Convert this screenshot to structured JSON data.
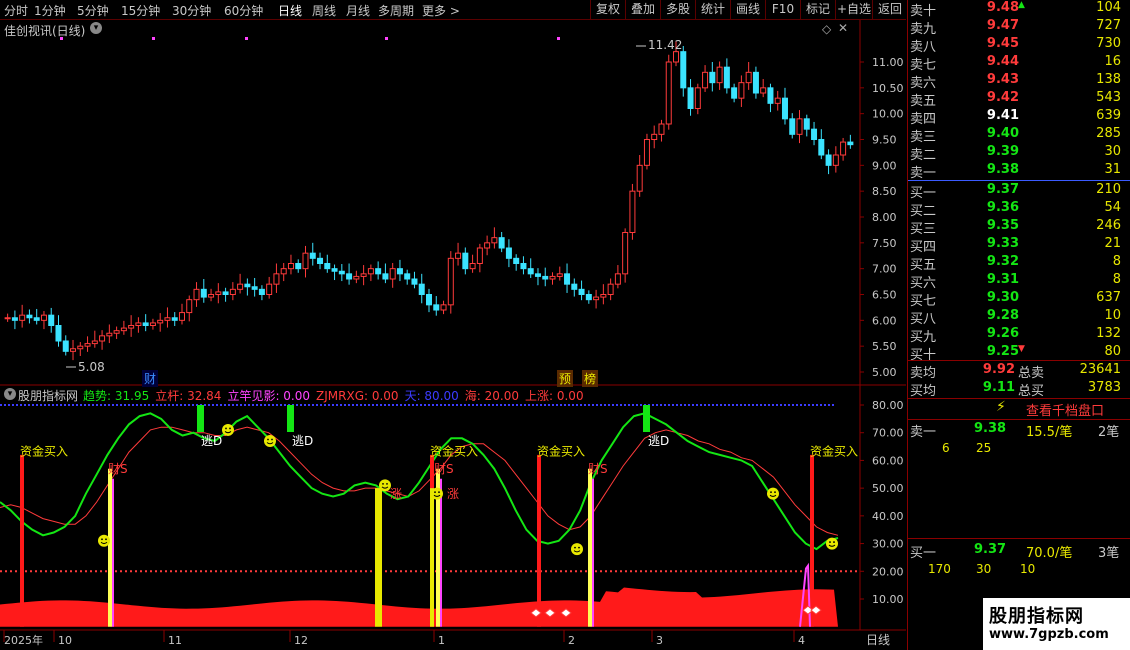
{
  "toolbar": {
    "periods": [
      "分时",
      "1分钟",
      "5分钟",
      "15分钟",
      "30分钟",
      "60分钟",
      "日线",
      "周线",
      "月线",
      "多周期",
      "更多 >"
    ],
    "actions": [
      "复权",
      "叠加",
      "多股",
      "统计",
      "画线",
      "F10",
      "标记",
      "+自选",
      "返回"
    ]
  },
  "chart": {
    "title": "佳创视讯(日线)",
    "high_label": "11.42",
    "low_label": "5.08",
    "y_ticks": [
      "11.00",
      "10.50",
      "10.00",
      "9.50",
      "9.00",
      "8.50",
      "8.00",
      "7.50",
      "7.00",
      "6.50",
      "6.00",
      "5.50",
      "5.00"
    ],
    "markers": [
      "财",
      "预",
      "榜"
    ],
    "indicator": {
      "name": "股朋指标网",
      "legend": [
        {
          "text": "趋势: 31.95",
          "color": "#14e614"
        },
        {
          "text": "立杆: 32.84",
          "color": "#ff3b3b"
        },
        {
          "text": "立竿见影: 0.00",
          "color": "#ff44ff"
        },
        {
          "text": "ZJMRXG: 0.00",
          "color": "#ff3b3b"
        },
        {
          "text": "天: 80.00",
          "color": "#3b3bff"
        },
        {
          "text": "海: 20.00",
          "color": "#ff3b3b"
        },
        {
          "text": "上涨: 0.00",
          "color": "#ff3b3b"
        }
      ],
      "y_ticks": [
        "80.00",
        "70.00",
        "60.00",
        "50.00",
        "40.00",
        "30.00",
        "20.00",
        "10.00"
      ],
      "signals": {
        "buy": "资金买入",
        "escape": "逃D",
        "fortune": "财S",
        "rise": "涨"
      }
    },
    "date_axis": [
      "2025年",
      "10",
      "11",
      "12",
      "1",
      "2",
      "3",
      "4"
    ],
    "period_label": "日线",
    "candles_high_low_note": ""
  },
  "panel": {
    "sells": [
      {
        "name": "卖十",
        "price": "9.48",
        "vol": "104",
        "color": "red",
        "arrow": "up"
      },
      {
        "name": "卖九",
        "price": "9.47",
        "vol": "727",
        "color": "red"
      },
      {
        "name": "卖八",
        "price": "9.45",
        "vol": "730",
        "color": "red"
      },
      {
        "name": "卖七",
        "price": "9.44",
        "vol": "16",
        "color": "red"
      },
      {
        "name": "卖六",
        "price": "9.43",
        "vol": "138",
        "color": "red"
      },
      {
        "name": "卖五",
        "price": "9.42",
        "vol": "543",
        "color": "red"
      },
      {
        "name": "卖四",
        "price": "9.41",
        "vol": "639",
        "color": "white"
      },
      {
        "name": "卖三",
        "price": "9.40",
        "vol": "285",
        "color": "green"
      },
      {
        "name": "卖二",
        "price": "9.39",
        "vol": "30",
        "color": "green"
      },
      {
        "name": "卖一",
        "price": "9.38",
        "vol": "31",
        "color": "green"
      }
    ],
    "buys": [
      {
        "name": "买一",
        "price": "9.37",
        "vol": "210",
        "color": "green"
      },
      {
        "name": "买二",
        "price": "9.36",
        "vol": "54",
        "color": "green"
      },
      {
        "name": "买三",
        "price": "9.35",
        "vol": "246",
        "color": "green"
      },
      {
        "name": "买四",
        "price": "9.33",
        "vol": "21",
        "color": "green"
      },
      {
        "name": "买五",
        "price": "9.32",
        "vol": "8",
        "color": "green"
      },
      {
        "name": "买六",
        "price": "9.31",
        "vol": "8",
        "color": "green"
      },
      {
        "name": "买七",
        "price": "9.30",
        "vol": "637",
        "color": "green"
      },
      {
        "name": "买八",
        "price": "9.28",
        "vol": "10",
        "color": "green"
      },
      {
        "name": "买九",
        "price": "9.26",
        "vol": "132",
        "color": "green"
      },
      {
        "name": "买十",
        "price": "9.25",
        "vol": "80",
        "color": "green",
        "arrow": "down"
      }
    ],
    "avg_sell": {
      "label": "卖均",
      "price": "9.92",
      "total_label": "总卖",
      "total": "23641"
    },
    "avg_buy": {
      "label": "买均",
      "price": "9.11",
      "total_label": "总买",
      "total": "3783"
    },
    "depth_button": "查看千档盘口",
    "sell1_detail": {
      "label": "卖一",
      "price": "9.38",
      "avg": "15.5/笔",
      "count": "2笔",
      "orders": [
        "6",
        "25"
      ]
    },
    "buy1_detail": {
      "label": "买一",
      "price": "9.37",
      "avg": "70.0/笔",
      "count": "3笔",
      "orders": [
        "170",
        "30",
        "10"
      ]
    },
    "watermark": "股朋指标网",
    "watermark_url": "www.7gpzb.com"
  }
}
